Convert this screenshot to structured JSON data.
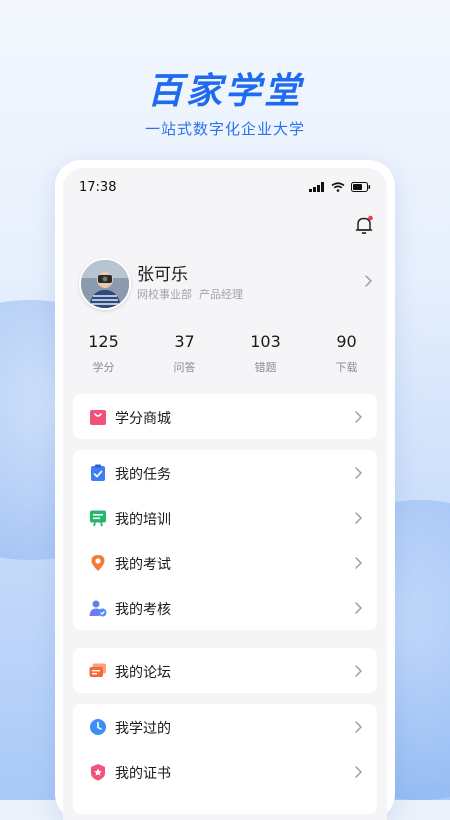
{
  "brand": {
    "title": "百家学堂",
    "slogan": "一站式数字化企业大学"
  },
  "status": {
    "time": "17:38"
  },
  "profile": {
    "name": "张可乐",
    "department": "网校事业部",
    "role": "产品经理"
  },
  "stats": [
    {
      "value": "125",
      "label": "学分"
    },
    {
      "value": "37",
      "label": "问答"
    },
    {
      "value": "103",
      "label": "错题"
    },
    {
      "value": "90",
      "label": "下载"
    }
  ],
  "groups": [
    [
      {
        "label": "学分商城",
        "icon": "shop-bag-icon",
        "color": "#f2517a"
      }
    ],
    [
      {
        "label": "我的任务",
        "icon": "task-clipboard-icon",
        "color": "#3d7ef5"
      },
      {
        "label": "我的培训",
        "icon": "training-board-icon",
        "color": "#25b86c"
      },
      {
        "label": "我的考试",
        "icon": "exam-location-icon",
        "color": "#f47a3a"
      },
      {
        "label": "我的考核",
        "icon": "assessment-user-icon",
        "color": "#6c7cf1"
      }
    ],
    [
      {
        "label": "我的论坛",
        "icon": "forum-chat-icon",
        "color": "#f46b3a"
      }
    ],
    [
      {
        "label": "我学过的",
        "icon": "history-clock-icon",
        "color": "#3d8ef5"
      },
      {
        "label": "我的证书",
        "icon": "certificate-badge-icon",
        "color": "#f2517a"
      }
    ]
  ]
}
